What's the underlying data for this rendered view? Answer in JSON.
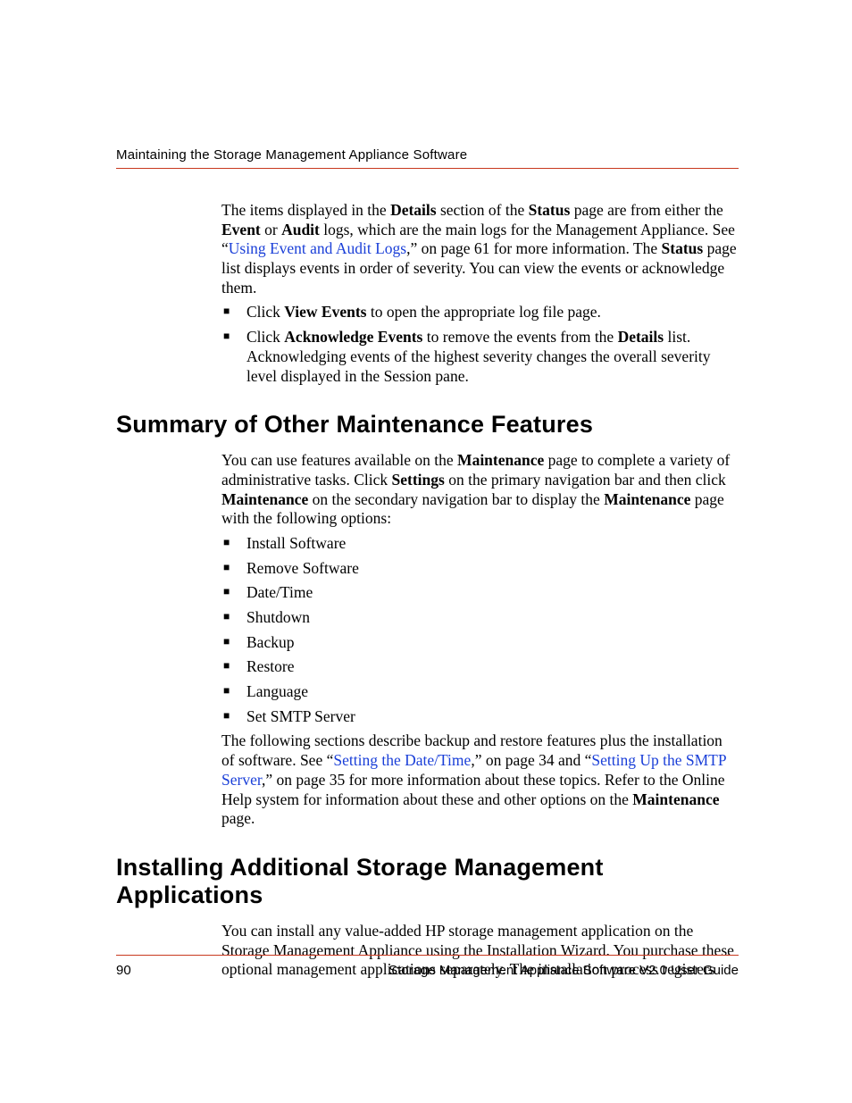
{
  "header": {
    "chapter_title": "Maintaining the Storage Management Appliance Software"
  },
  "intro": {
    "pre_details": "The items displayed in the ",
    "details": "Details",
    "post_details": " section of the ",
    "status": "Status",
    "post_status": " page are from either the ",
    "event": "Event",
    "or": " or ",
    "audit": "Audit",
    "post_audit": " logs, which are the main logs for the Management Appliance. See “",
    "link_text": "Using Event and Audit Logs",
    "post_link": ",” on page 61 for more information. The ",
    "status2": "Status",
    "tail": " page list displays events in order of severity. You can view the events or acknowledge them."
  },
  "intro_list": {
    "item1": {
      "pre": "Click ",
      "bold": "View Events",
      "post": " to open the appropriate log file page."
    },
    "item2": {
      "pre": "Click ",
      "bold1": "Acknowledge Events",
      "mid": " to remove the events from the ",
      "bold2": "Details",
      "post": " list. Acknowledging events of the highest severity changes the overall severity level displayed in the Session pane."
    }
  },
  "section1": {
    "heading": "Summary of Other Maintenance Features",
    "para_pre": "You can use features available on the ",
    "maintenance1": "Maintenance",
    "para_mid1": " page to complete a variety of administrative tasks. Click ",
    "settings": "Settings",
    "para_mid2": " on the primary navigation bar and then click ",
    "maintenance2": "Maintenance",
    "para_mid3": " on the secondary navigation bar to display the ",
    "maintenance3": "Maintenance",
    "para_tail": " page with the following options:",
    "options": [
      "Install Software",
      "Remove Software",
      "Date/Time",
      "Shutdown",
      "Backup",
      "Restore",
      "Language",
      "Set SMTP Server"
    ],
    "closing_pre": "The following sections describe backup and restore features plus the installation of software. See “",
    "link1": "Setting the Date/Time",
    "closing_mid1": ",” on page 34 and “",
    "link2": "Setting Up the SMTP Server",
    "closing_mid2": ",” on page 35 for more information about these topics. Refer to the Online Help system for information about these and other options on the ",
    "maintenance4": "Maintenance",
    "closing_tail": " page."
  },
  "section2": {
    "heading": "Installing Additional Storage Management Applications",
    "para": "You can install any value-added HP storage management application on the Storage Management Appliance using the Installation Wizard. You purchase these optional management applications separately. The installation process registers"
  },
  "footer": {
    "page_number": "90",
    "doc_title": "Storage Management Appliance Software V2.0 User Guide"
  }
}
